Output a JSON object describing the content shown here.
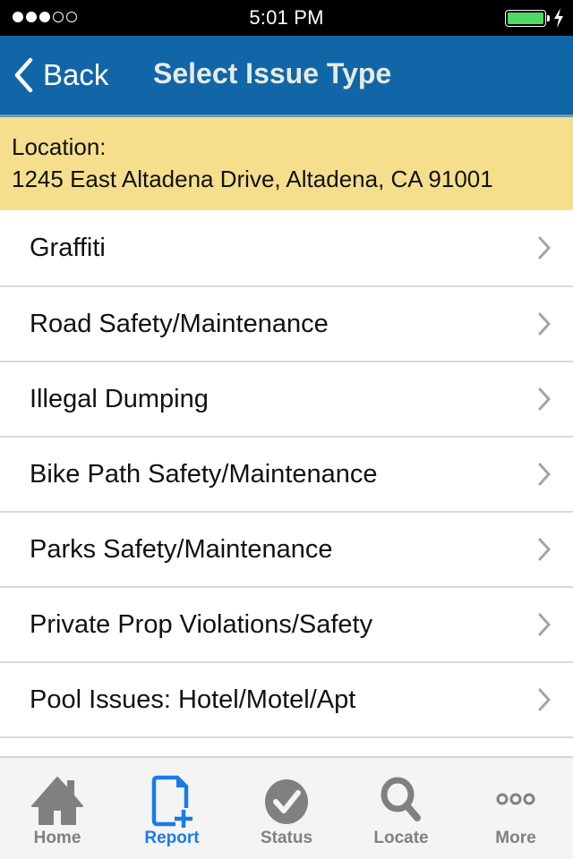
{
  "status_bar": {
    "signal_bars_filled": 3,
    "signal_bars_total": 5,
    "time": "5:01 PM",
    "battery_level": 1.0,
    "charging": true,
    "battery_color": "#4cd964"
  },
  "nav": {
    "back_label": "Back",
    "title": "Select Issue Type",
    "bar_color": "#1166a8"
  },
  "location": {
    "label": "Location:",
    "address": "1245 East Altadena Drive, Altadena, CA 91001",
    "bg_color": "#f5df8c"
  },
  "issue_types": [
    {
      "label": "Graffiti"
    },
    {
      "label": "Road Safety/Maintenance"
    },
    {
      "label": "Illegal Dumping"
    },
    {
      "label": "Bike Path Safety/Maintenance"
    },
    {
      "label": "Parks Safety/Maintenance"
    },
    {
      "label": "Private Prop Violations/Safety"
    },
    {
      "label": "Pool Issues: Hotel/Motel/Apt"
    },
    {
      "label": ""
    }
  ],
  "tabs": [
    {
      "label": "Home",
      "icon": "home-icon",
      "active": false
    },
    {
      "label": "Report",
      "icon": "report-add-icon",
      "active": true
    },
    {
      "label": "Status",
      "icon": "checkmark-circle-icon",
      "active": false
    },
    {
      "label": "Locate",
      "icon": "search-icon",
      "active": false
    },
    {
      "label": "More",
      "icon": "more-dots-icon",
      "active": false
    }
  ],
  "colors": {
    "tab_active": "#1a7be6",
    "tab_inactive": "#808080"
  }
}
